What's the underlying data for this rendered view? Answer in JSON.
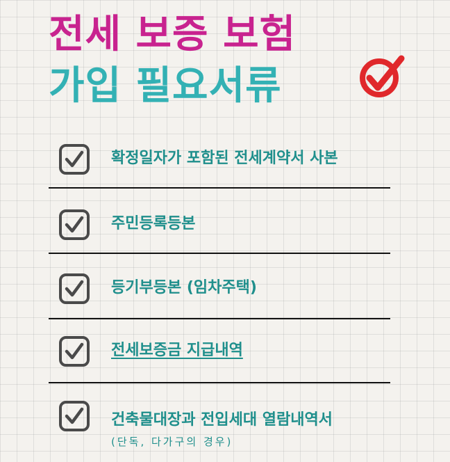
{
  "title": {
    "line1": "전세 보증 보험",
    "line2": "가입 필요서류"
  },
  "colors": {
    "title_line1": "#c8238f",
    "title_line2": "#33b1b4",
    "title_check": "#e0282b",
    "item_text": "#1f8f8c",
    "checkbox": "#4a4a4a",
    "background": "#f4f2ee"
  },
  "icons": {
    "title_check": "red-circle-check-icon",
    "item_check": "checkbox-checked-icon"
  },
  "items": [
    {
      "label": "확정일자가 포함된 전세계약서 사본",
      "checked": true,
      "underlined": false
    },
    {
      "label": "주민등록등본",
      "checked": true,
      "underlined": false
    },
    {
      "label": "등기부등본 (임차주택)",
      "checked": true,
      "underlined": false
    },
    {
      "label": "전세보증금 지급내역",
      "checked": true,
      "underlined": true
    },
    {
      "label": "건축물대장과 전입세대 열람내역서",
      "note": "(단독, 다가구의 경우)",
      "checked": true,
      "underlined": false
    }
  ]
}
